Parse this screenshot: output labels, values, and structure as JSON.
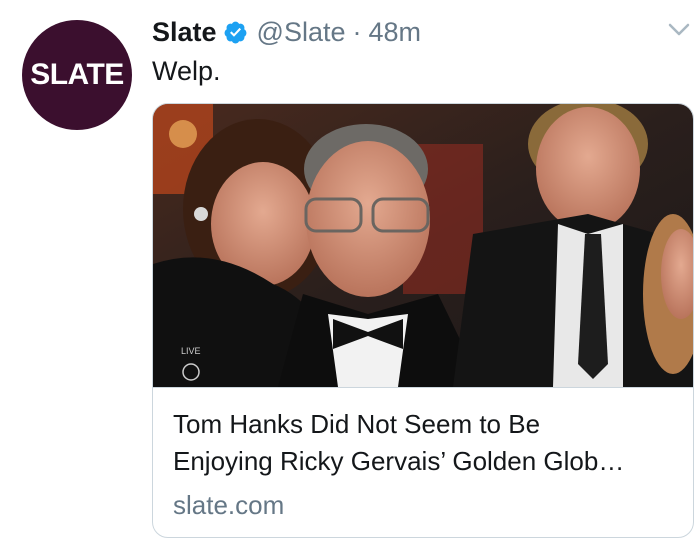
{
  "account": {
    "avatar_text": "SLATE",
    "display_name": "Slate",
    "handle": "@Slate",
    "separator": "·",
    "time": "48m",
    "verified_icon": "verified-badge-icon",
    "menu_icon": "chevron-down-icon"
  },
  "tweet": {
    "text": "Welp."
  },
  "card": {
    "image_overlay_live": "LIVE",
    "title_line1": "Tom Hanks Did Not Seem to Be",
    "title_line2": "Enjoying Ricky Gervais’ Golden Glob…",
    "domain": "slate.com"
  },
  "colors": {
    "avatar_bg": "#3b0f2e",
    "verified": "#1da1f2",
    "secondary_text": "#657786",
    "border": "#ccd6dd"
  }
}
